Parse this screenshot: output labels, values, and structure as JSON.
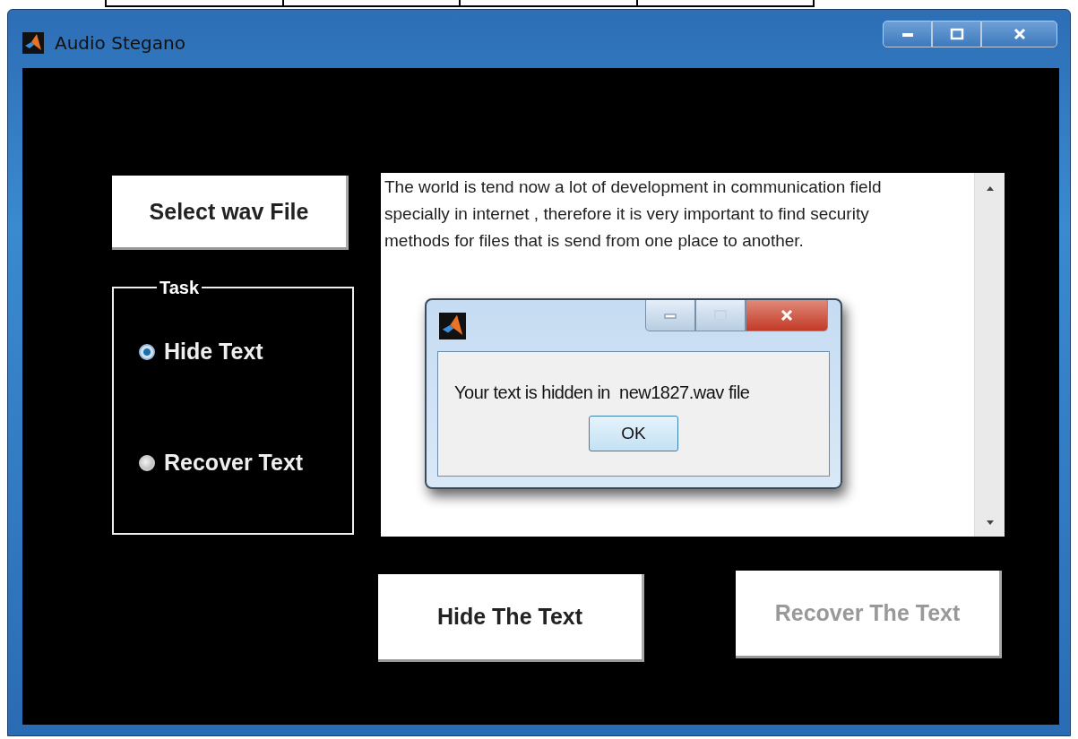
{
  "window": {
    "title": "Audio Stegano"
  },
  "select_button": {
    "label": "Select wav File"
  },
  "task": {
    "title": "Task",
    "options": [
      {
        "label": "Hide Text",
        "selected": true
      },
      {
        "label": "Recover Text",
        "selected": false
      }
    ]
  },
  "text_area": {
    "value": "The world is tend now a lot of development in communication field specially in internet , therefore it is very important to find security methods for files that is send from one place to another."
  },
  "buttons": [
    {
      "label": "Hide The Text",
      "disabled": false
    },
    {
      "label": "Recover The Text",
      "disabled": true
    }
  ],
  "dialog": {
    "message": "Your text is hidden in  new1827.wav file",
    "ok_button": "OK"
  }
}
